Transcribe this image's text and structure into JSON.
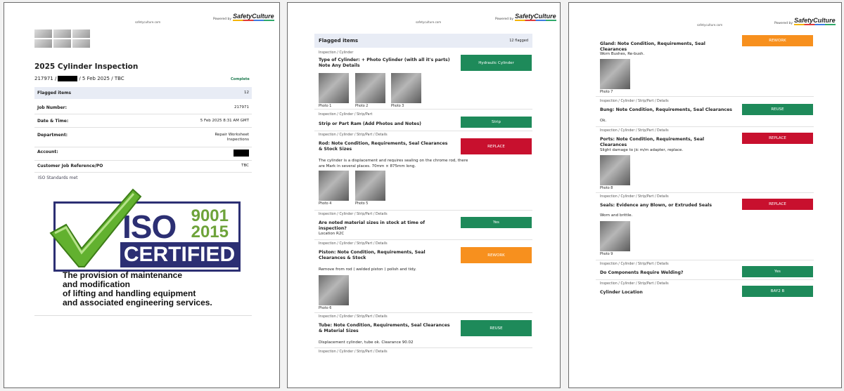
{
  "header": {
    "url": "safetyculture.com",
    "powered_by": "Powered by",
    "brand": "SafetyCulture"
  },
  "page1": {
    "title": "2025 Cylinder Inspection",
    "job_id": "217971 /",
    "date_tail": "/ 5 Feb 2025 / TBC",
    "status": "Complete",
    "rows": [
      {
        "label": "Flagged items",
        "value": "12"
      },
      {
        "label": "Job Number:",
        "value": "217971"
      },
      {
        "label": "Date & Time:",
        "value": "5 Feb 2025 8:31 AM GMT"
      },
      {
        "label": "Department:",
        "value": "Repair Worksheet\nInspections"
      },
      {
        "label": "Account:",
        "value": ""
      },
      {
        "label": "Customer Job Reference/PO",
        "value": "TBC"
      }
    ],
    "iso_note": "ISO Standards met",
    "iso": {
      "word": "ISO",
      "num1": "9001",
      "num2": "2015",
      "certified": "CERTIFIED",
      "line1": "The provision of maintenance",
      "line2": "and modification",
      "line3": "of lifting and handling equipment",
      "line4": "and associated engineering services."
    }
  },
  "page2": {
    "flagged_title": "Flagged items",
    "flagged_count": "12 flagged",
    "items": [
      {
        "crumb": "Inspection / Cylinder",
        "q": "Type of Cylinder: + Photo Cylinder (with all it's parts) Note Any Details",
        "a": "Hydraulic Cylinder",
        "note": "",
        "photos": [
          "Photo 1",
          "Photo 2",
          "Photo 3"
        ]
      },
      {
        "crumb": "Inspection / Cylinder / Strip/Part",
        "q": "Strip or Part Ram (Add Photos and Notes)",
        "a": "Strip",
        "note": "",
        "photos": []
      },
      {
        "crumb": "Inspection / Cylinder / Strip/Part / Details",
        "q": "Rod: Note Condition, Requirements, Seal Clearances & Stock Sizes",
        "a": "REPLACE",
        "note": "The cylinder is a displacement and requires sealing on the chrome rod, there are Mark in several places. 70mm × 875mm long.",
        "photos": [
          "Photo 4",
          "Photo 5"
        ]
      },
      {
        "crumb": "Inspection / Cylinder / Strip/Part / Details",
        "q": "Are noted material sizes in stock at time of inspection?",
        "a": "Yes",
        "note": "Location R2C",
        "photos": []
      },
      {
        "crumb": "Inspection / Cylinder / Strip/Part / Details",
        "q": "Piston: Note Condition, Requirements, Seal Clearances & Stock",
        "a": "REWORK",
        "note": "Remove from rod ( welded piston ) polish and tidy.",
        "photos": [
          "Photo 6"
        ]
      },
      {
        "crumb": "Inspection / Cylinder / Strip/Part / Details",
        "q": "Tube: Note Condition, Requirements, Seal Clearances & Material Sizes",
        "a": "REUSE",
        "note": "Displacement cylinder, tube ok. Clearance 90.02",
        "photos": []
      },
      {
        "crumb": "Inspection / Cylinder / Strip/Part / Details",
        "q": "",
        "a": "",
        "note": "",
        "photos": []
      }
    ]
  },
  "page3": {
    "items": [
      {
        "crumb": "",
        "q": "Gland: Note Condition, Requirements, Seal Clearances",
        "a": "REWORK",
        "note": "Worn Bushes, Re-bush.",
        "photos": [
          "Photo 7"
        ]
      },
      {
        "crumb": "Inspection / Cylinder / Strip/Part / Details",
        "q": "Bung: Note Condition, Requirements, Seal Clearances",
        "a": "REUSE",
        "note": "Ok.",
        "photos": []
      },
      {
        "crumb": "Inspection / Cylinder / Strip/Part / Details",
        "q": "Ports: Note Condition, Requirements, Seal Clearances",
        "a": "REPLACE",
        "note": "Slight damage to jic m/m adapter, replace.",
        "photos": [
          "Photo 8"
        ]
      },
      {
        "crumb": "Inspection / Cylinder / Strip/Part / Details",
        "q": "Seals: Evidence any Blown, or Extruded Seals",
        "a": "REPLACE",
        "note": "Worn and brittle.",
        "photos": [
          "Photo 9"
        ]
      },
      {
        "crumb": "Inspection / Cylinder / Strip/Part / Details",
        "q": "Do Components Require Welding?",
        "a": "Yes",
        "note": "",
        "photos": []
      },
      {
        "crumb": "Inspection / Cylinder / Strip/Part / Details",
        "q": "Cylinder Location",
        "a": "BAY2 B",
        "note": "",
        "photos": []
      }
    ]
  },
  "colors": {
    "green": "#1e8a5a",
    "red": "#c8102e",
    "orange": "#f7901e",
    "iso_navy": "#2c2f73",
    "iso_green": "#6ea33a"
  }
}
